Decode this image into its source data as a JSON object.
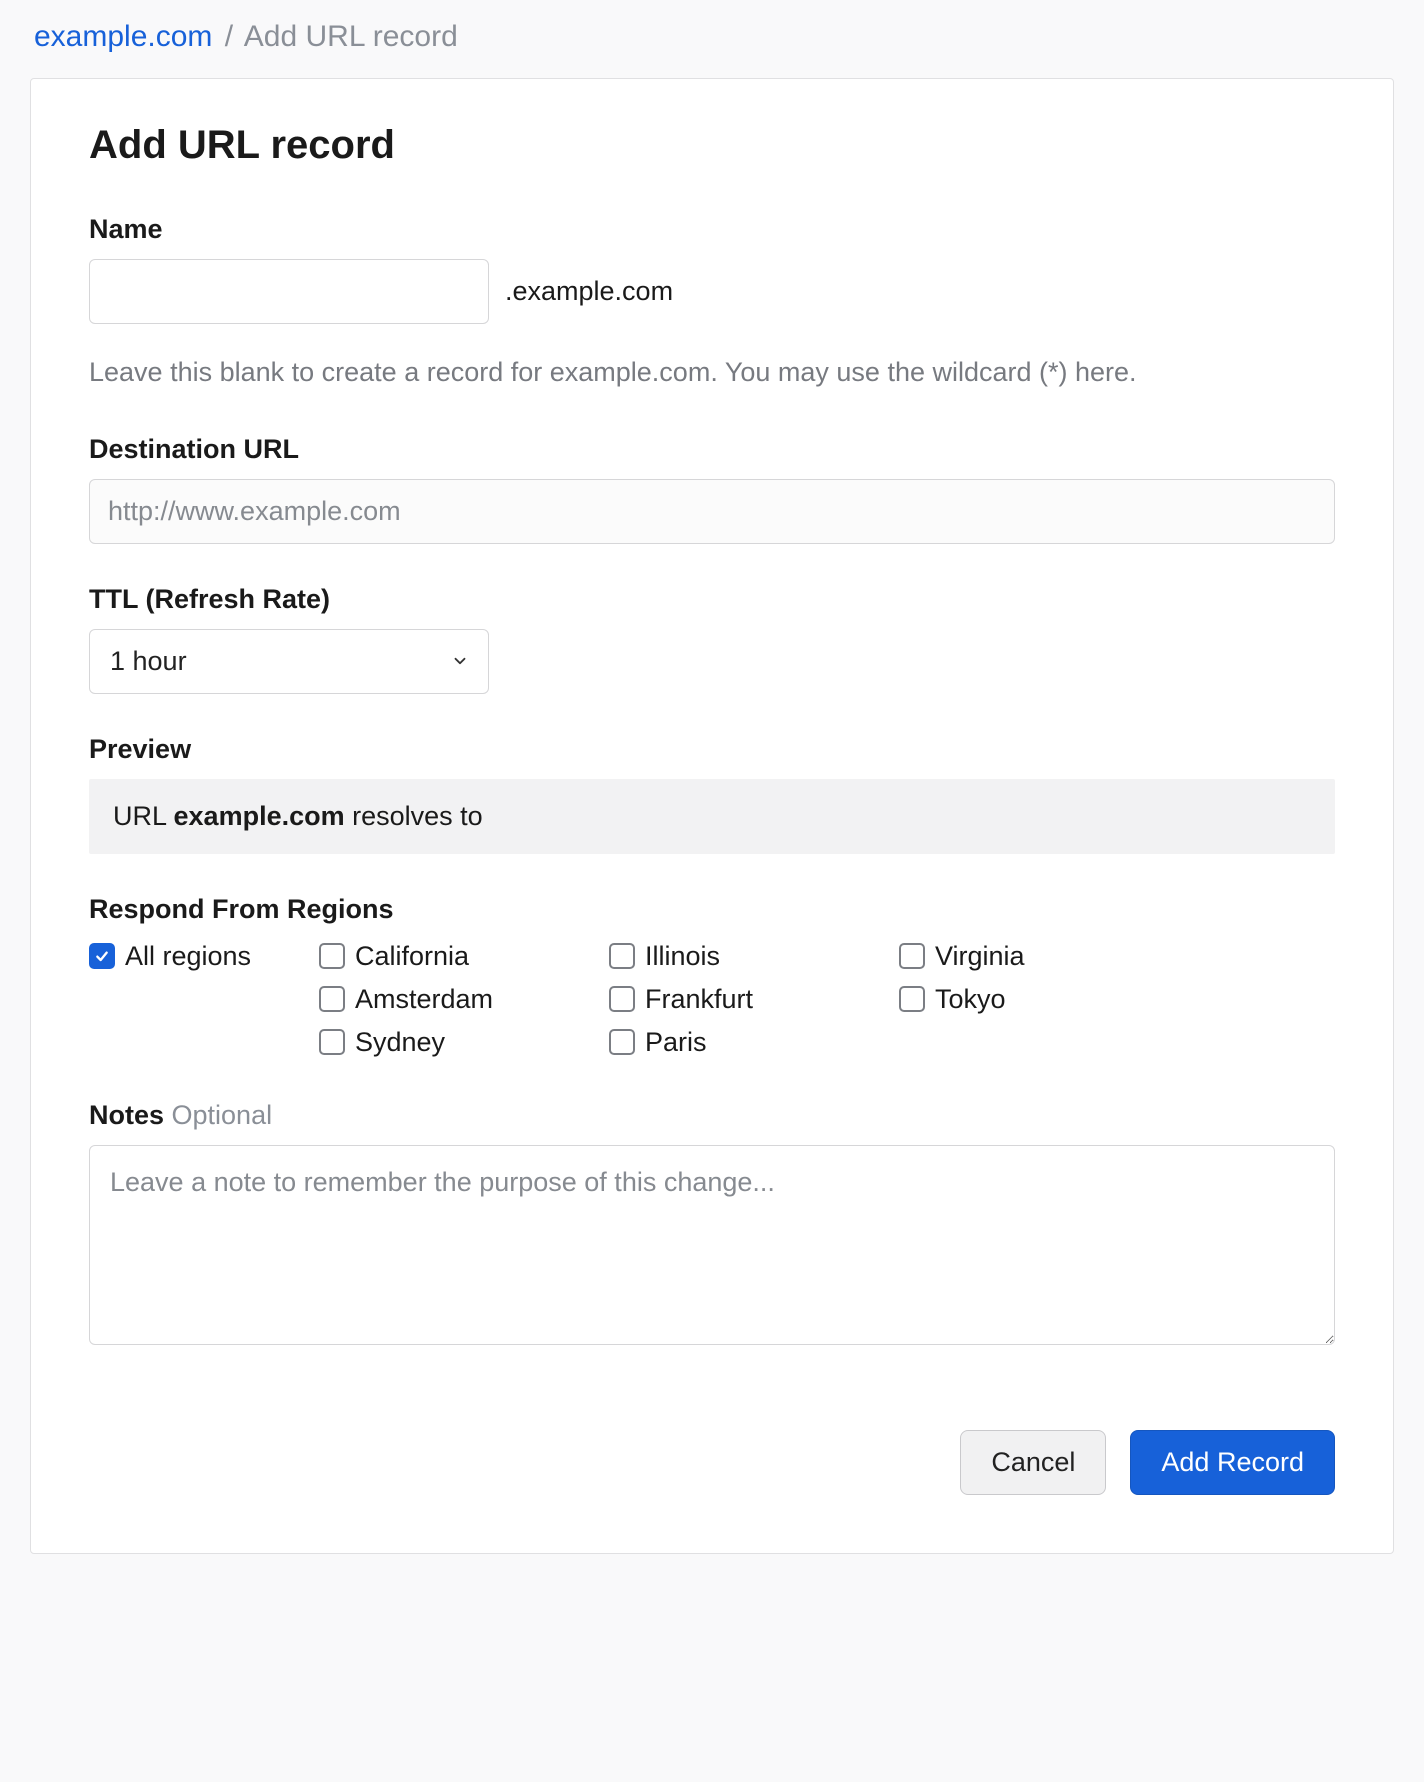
{
  "breadcrumb": {
    "link": "example.com",
    "sep": "/",
    "current": "Add URL record"
  },
  "title": "Add URL record",
  "name": {
    "label": "Name",
    "value": "",
    "suffix": ".example.com",
    "help": "Leave this blank to create a record for example.com. You may use the wildcard (*) here."
  },
  "dest": {
    "label": "Destination URL",
    "value": "",
    "placeholder": "http://www.example.com"
  },
  "ttl": {
    "label": "TTL (Refresh Rate)",
    "selected": "1 hour"
  },
  "preview": {
    "label": "Preview",
    "prefix": "URL ",
    "domain": "example.com",
    "suffix": " resolves to"
  },
  "regions": {
    "label": "Respond From Regions",
    "col0": [
      {
        "label": "All regions",
        "checked": true
      }
    ],
    "col1": [
      {
        "label": "California",
        "checked": false
      },
      {
        "label": "Amsterdam",
        "checked": false
      },
      {
        "label": "Sydney",
        "checked": false
      }
    ],
    "col2": [
      {
        "label": "Illinois",
        "checked": false
      },
      {
        "label": "Frankfurt",
        "checked": false
      },
      {
        "label": "Paris",
        "checked": false
      }
    ],
    "col3": [
      {
        "label": "Virginia",
        "checked": false
      },
      {
        "label": "Tokyo",
        "checked": false
      }
    ]
  },
  "notes": {
    "label": "Notes",
    "optional": " Optional",
    "value": "",
    "placeholder": "Leave a note to remember the purpose of this change..."
  },
  "actions": {
    "cancel": "Cancel",
    "submit": "Add Record"
  }
}
